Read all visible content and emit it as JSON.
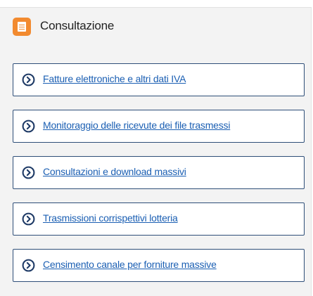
{
  "header": {
    "title": "Consultazione",
    "icon": "document-icon",
    "icon_color": "#f28a2f"
  },
  "links": [
    {
      "label": "Fatture elettroniche e altri dati IVA",
      "icon": "arrow-right-circle-icon"
    },
    {
      "label": "Monitoraggio delle ricevute dei file trasmessi",
      "icon": "arrow-right-circle-icon"
    },
    {
      "label": "Consultazioni e download massivi",
      "icon": "arrow-right-circle-icon"
    },
    {
      "label": "Trasmissioni corrispettivi lotteria",
      "icon": "arrow-right-circle-icon"
    },
    {
      "label": "Censimento canale per forniture massive",
      "icon": "arrow-right-circle-icon"
    }
  ],
  "colors": {
    "link": "#1b5fb3",
    "card_border": "#2e4e78",
    "arrow": "#1e3a66",
    "panel_background": "#f3f3f3"
  }
}
